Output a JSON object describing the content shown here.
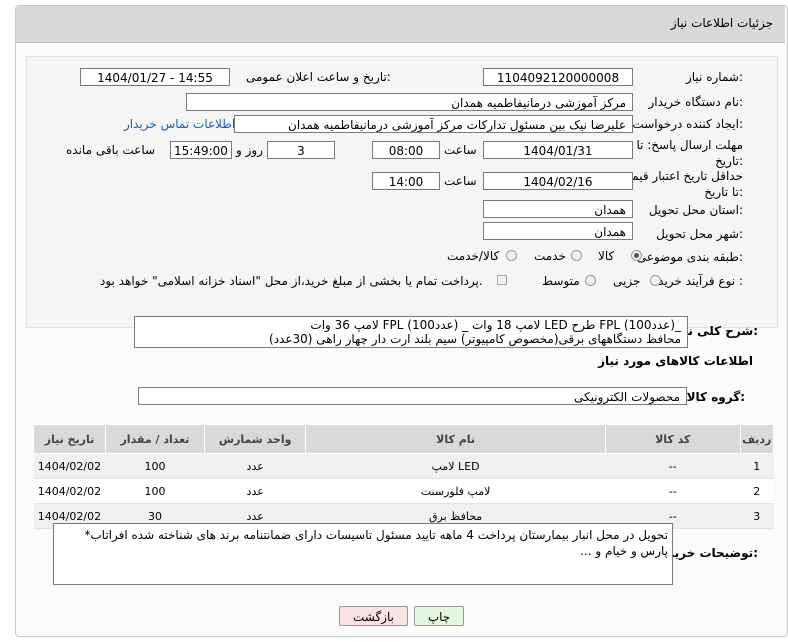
{
  "title": "جزئیات اطلاعات نیاز",
  "need_number": {
    "label": "شماره نیاز:",
    "value": "1104092120000008"
  },
  "announce": {
    "label": "تاریخ و ساعت اعلان عمومی:",
    "value": "1404/01/27 - 14:55"
  },
  "buyer": {
    "label": "نام دستگاه خریدار:",
    "value": "مرکز آموزشی درمانیفاطمیه همدان"
  },
  "creator": {
    "label": "ایجاد کننده درخواست:",
    "value": "علیرضا نیک بین مسئول تدارکات مرکز آموزشی درمانیفاطمیه همدان",
    "contact_link": "اطلاعات تماس خریدار"
  },
  "deadline": {
    "label": "مهلت ارسال پاسخ: تا تاریخ:",
    "date": "1404/01/31",
    "time_label": "ساعت",
    "time": "08:00",
    "days": "3",
    "days_label": "روز و",
    "remaining": "15:49:00",
    "remaining_label": "ساعت باقی مانده"
  },
  "validity": {
    "label": "حداقل تاریخ اعتبار قیمت: تا تاریخ:",
    "date": "1404/02/16",
    "time_label": "ساعت",
    "time": "14:00"
  },
  "province": {
    "label": "استان محل تحویل:",
    "value": "همدان"
  },
  "city": {
    "label": "شهر محل تحویل:",
    "value": "همدان"
  },
  "category": {
    "label": "طبقه بندی موضوعی:",
    "options": [
      "کالا",
      "خدمت",
      "کالا/خدمت"
    ]
  },
  "process": {
    "label": "نوع فرآیند خرید :",
    "options": [
      "جزیی",
      "متوسط"
    ],
    "note": "پرداخت تمام یا بخشی از مبلغ خرید،از محل \"اسناد خزانه اسلامی\" خواهد بود."
  },
  "description": {
    "label": "شرح کلی نیاز:",
    "line1": "لامپ 36 وات FPL    (عدد100)   _     لامپ 18 وات LED طرح FPL    (عدد100)_",
    "line2": "محافظ دستگاههای برقی(مخصوص کامپیوتر) سیم بلند ارت دار چهار راهی     (30عدد)"
  },
  "goods_section": {
    "title": "اطلاعات کالاهای مورد نیاز",
    "group_label": "گروه کالا:",
    "group_value": "محصولات الکترونیکی"
  },
  "table": {
    "headers": [
      "ردیف",
      "کد کالا",
      "نام کالا",
      "واحد شمارش",
      "تعداد / مقدار",
      "تاریخ نیاز"
    ],
    "rows": [
      {
        "idx": "1",
        "code": "--",
        "name": "لامپ LED",
        "unit": "عدد",
        "qty": "100",
        "date": "1404/02/02"
      },
      {
        "idx": "2",
        "code": "--",
        "name": "لامپ فلورسنت",
        "unit": "عدد",
        "qty": "100",
        "date": "1404/02/02"
      },
      {
        "idx": "3",
        "code": "--",
        "name": "محافظ برق",
        "unit": "عدد",
        "qty": "30",
        "date": "1404/02/02"
      }
    ]
  },
  "buyer_notes": {
    "label": "توضیحات خریدار:",
    "value": "تحویل در محل انبار بیمارستان پرداخت 4 ماهه تایید مسئول تاسیسات دارای ضمانتنامه برند های شناخته شده افراتاب* پارس و خیام و ..."
  },
  "buttons": {
    "print": "چاپ",
    "back": "بازگشت"
  }
}
